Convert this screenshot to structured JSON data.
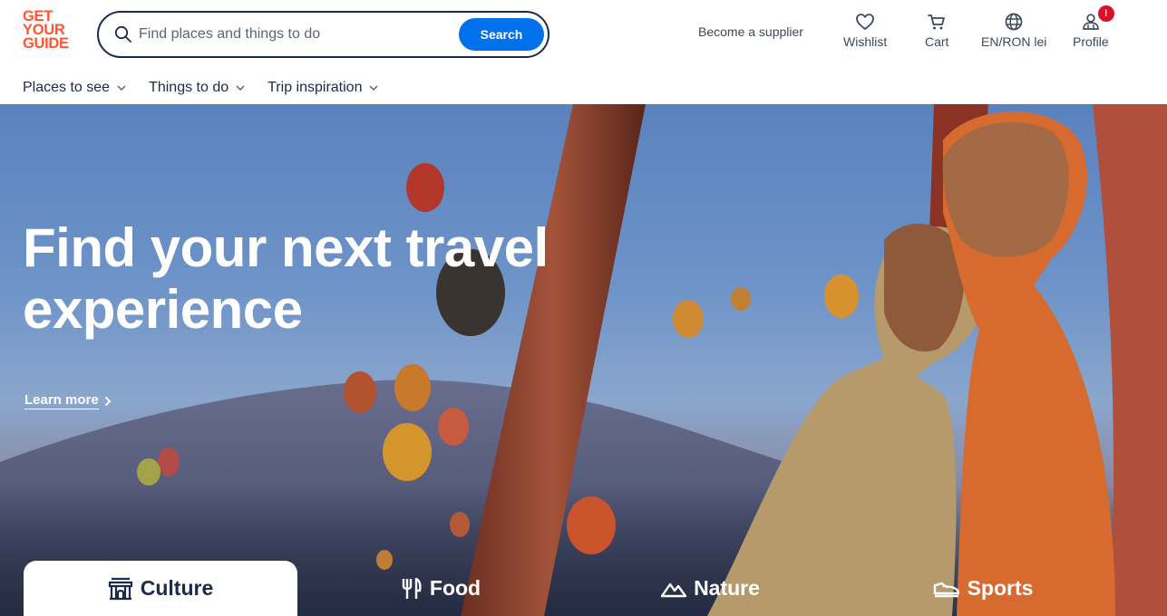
{
  "brand": {
    "line1": "GET",
    "line2": "YOUR",
    "line3": "GUIDE",
    "color": "#ff5533"
  },
  "search": {
    "placeholder": "Find places and things to do",
    "button_label": "Search",
    "button_color": "#0071eb"
  },
  "header": {
    "supplier_label": "Become a supplier",
    "wishlist_label": "Wishlist",
    "cart_label": "Cart",
    "locale_label": "EN/RON lei",
    "profile_label": "Profile",
    "profile_badge": "!"
  },
  "nav": [
    {
      "label": "Places to see"
    },
    {
      "label": "Things to do"
    },
    {
      "label": "Trip inspiration"
    }
  ],
  "hero": {
    "title_line1": "Find your next travel",
    "title_line2": "experience",
    "learn_more": "Learn more"
  },
  "categories": [
    {
      "label": "Culture",
      "icon": "landmark-icon",
      "active": true
    },
    {
      "label": "Food",
      "icon": "fork-knife-icon",
      "active": false
    },
    {
      "label": "Nature",
      "icon": "mountain-icon",
      "active": false
    },
    {
      "label": "Sports",
      "icon": "sneaker-icon",
      "active": false
    }
  ]
}
